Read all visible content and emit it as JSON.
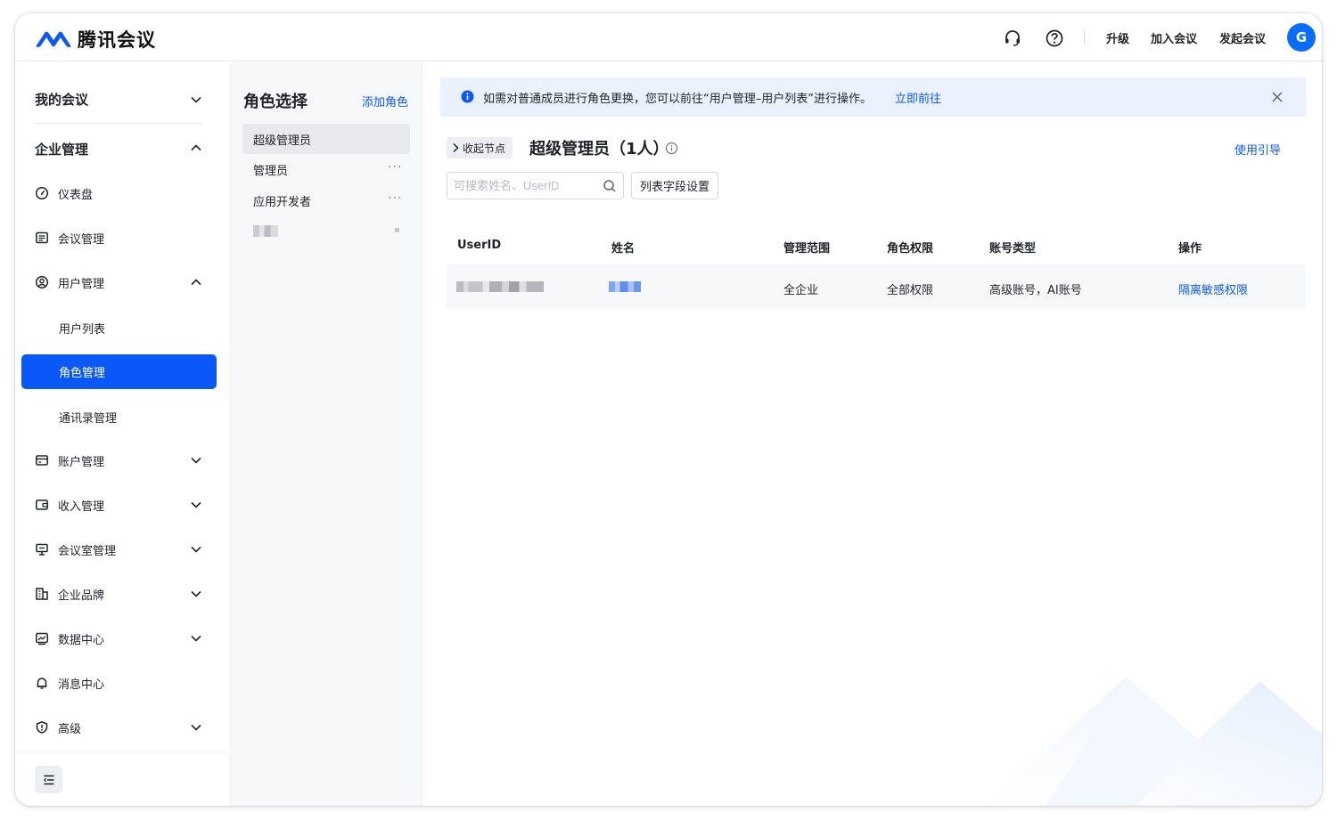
{
  "app": {
    "name": "腾讯会议",
    "brand_color": "#0a59f7"
  },
  "header": {
    "icons": [
      "headset-icon",
      "help-circle-icon"
    ],
    "links": {
      "upgrade": "升级",
      "join": "加入会议",
      "start": "发起会议"
    },
    "avatar_initial": "G"
  },
  "sidebar": {
    "my_meetings": "我的会议",
    "enterprise": "企业管理",
    "items": {
      "dashboard": "仪表盘",
      "meeting_mgmt": "会议管理",
      "user_mgmt": "用户管理",
      "user_list": "用户列表",
      "role_mgmt": "角色管理",
      "contacts_mgmt": "通讯录管理",
      "account_mgmt": "账户管理",
      "income_mgmt": "收入管理",
      "room_mgmt": "会议室管理",
      "brand": "企业品牌",
      "data_center": "数据中心",
      "message_center": "消息中心",
      "advanced": "高级"
    }
  },
  "roles": {
    "title": "角色选择",
    "add_label": "添加角色",
    "list": [
      "超级管理员",
      "管理员",
      "应用开发者"
    ],
    "more": "···"
  },
  "main": {
    "banner": {
      "text": "如需对普通成员进行角色更换，您可以前往“用户管理–用户列表”进行操作。",
      "link": "立即前往"
    },
    "collapse_label": "收起节点",
    "title": "超级管理员（1人）",
    "guide_link": "使用引导",
    "search_placeholder": "可搜索姓名、UserID",
    "field_settings": "列表字段设置",
    "table": {
      "headers": {
        "userid": "UserID",
        "name": "姓名",
        "scope": "管理范围",
        "permission": "角色权限",
        "account_type": "账号类型",
        "action": "操作"
      },
      "rows": [
        {
          "scope": "全企业",
          "permission": "全部权限",
          "account_type": "高级账号，AI账号",
          "action": "隔离敏感权限"
        }
      ]
    }
  }
}
